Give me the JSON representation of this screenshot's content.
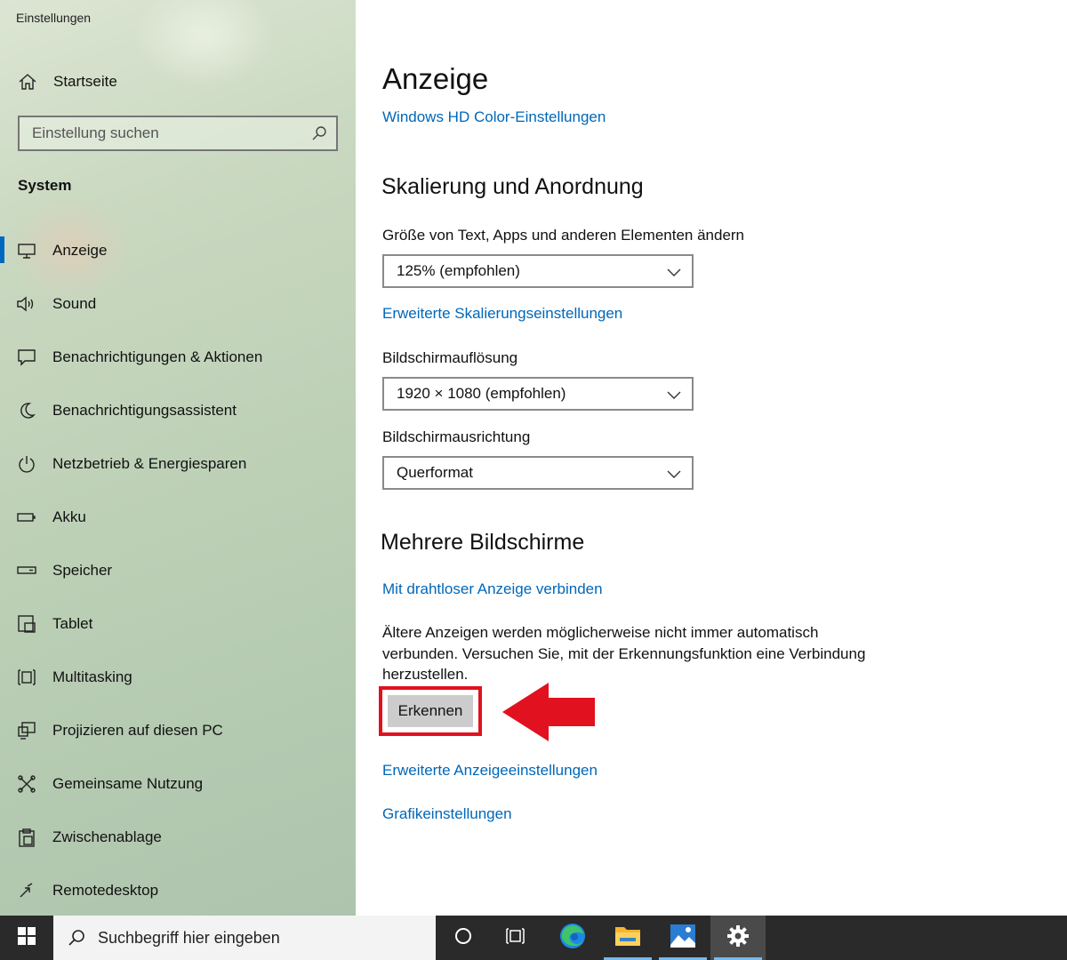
{
  "window": {
    "title": "Einstellungen"
  },
  "sidebar": {
    "home_label": "Startseite",
    "search_placeholder": "Einstellung suchen",
    "section_label": "System",
    "items": [
      {
        "label": "Anzeige",
        "icon": "monitor-icon",
        "active": true
      },
      {
        "label": "Sound",
        "icon": "speaker-icon"
      },
      {
        "label": "Benachrichtigungen & Aktionen",
        "icon": "notification-icon"
      },
      {
        "label": "Benachrichtigungsassistent",
        "icon": "moon-icon"
      },
      {
        "label": "Netzbetrieb & Energiesparen",
        "icon": "power-icon"
      },
      {
        "label": "Akku",
        "icon": "battery-icon"
      },
      {
        "label": "Speicher",
        "icon": "storage-icon"
      },
      {
        "label": "Tablet",
        "icon": "tablet-icon"
      },
      {
        "label": "Multitasking",
        "icon": "multitasking-icon"
      },
      {
        "label": "Projizieren auf diesen PC",
        "icon": "project-icon"
      },
      {
        "label": "Gemeinsame Nutzung",
        "icon": "share-icon"
      },
      {
        "label": "Zwischenablage",
        "icon": "clipboard-icon"
      },
      {
        "label": "Remotedesktop",
        "icon": "remote-icon"
      }
    ]
  },
  "main": {
    "title": "Anzeige",
    "hd_color_link": "Windows HD Color-Einstellungen",
    "scaling": {
      "heading": "Skalierung und Anordnung",
      "size_label": "Größe von Text, Apps und anderen Elementen ändern",
      "size_value": "125% (empfohlen)",
      "advanced_link": "Erweiterte Skalierungseinstellungen",
      "resolution_label": "Bildschirmauflösung",
      "resolution_value": "1920 × 1080 (empfohlen)",
      "orientation_label": "Bildschirmausrichtung",
      "orientation_value": "Querformat"
    },
    "multi": {
      "heading": "Mehrere Bildschirme",
      "wireless_link": "Mit drahtloser Anzeige verbinden",
      "description": "Ältere Anzeigen werden möglicherweise nicht immer automatisch verbunden. Versuchen Sie, mit der Erkennungsfunktion eine Verbindung herzustellen.",
      "detect_button": "Erkennen",
      "advanced_display_link": "Erweiterte Anzeigeeinstellungen",
      "graphics_link": "Grafikeinstellungen"
    },
    "annotation": {
      "highlight_color": "#e2111f"
    }
  },
  "taskbar": {
    "search_placeholder": "Suchbegriff hier eingeben",
    "icons": [
      "start-icon",
      "cortana-icon",
      "task-view-icon",
      "edge-icon",
      "file-explorer-icon",
      "photos-icon",
      "settings-icon"
    ]
  },
  "colors": {
    "accent": "#0067c0",
    "link": "#0067b8",
    "taskbar": "#2a2a2a"
  }
}
